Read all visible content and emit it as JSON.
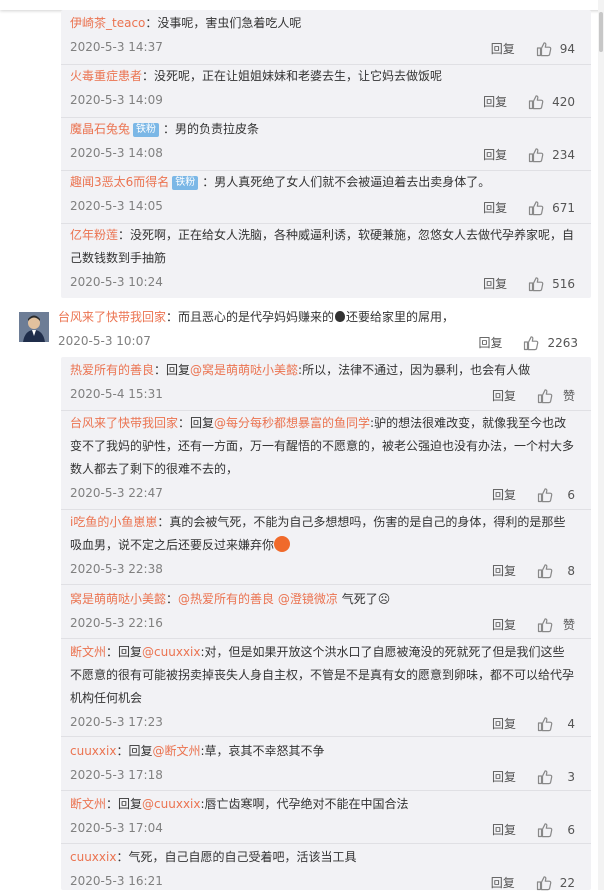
{
  "top_replies": [
    {
      "user": "伊崎茶_teaco",
      "text": "：没事呢，害虫们急着吃人呢",
      "time": "2020-5-3 14:37",
      "likes": "94"
    },
    {
      "user": "火毒重症患者",
      "text": "：没死呢，正在让姐姐妹妹和老婆去生，让它妈去做饭呢",
      "time": "2020-5-3 14:09",
      "likes": "420"
    },
    {
      "user": "魔晶石兔兔",
      "badge": "铁粉",
      "text": "：男的负责拉皮条",
      "time": "2020-5-3 14:08",
      "likes": "234"
    },
    {
      "user": "趣闻3恶太6而得名",
      "badge": "铁粉",
      "text": "：男人真死绝了女人们就不会被逼迫着去出卖身体了。",
      "time": "2020-5-3 14:05",
      "likes": "671"
    },
    {
      "user": "亿年粉莲",
      "text": "：没死啊，正在给女人洗脑，各种威逼利诱，软硬兼施，忽悠女人去做代孕养家呢，自己数钱数到手抽筋",
      "time": "2020-5-3 10:24",
      "likes": "516"
    }
  ],
  "main_comment": {
    "user": "台风来了快带我回家",
    "text_a": "：而且恶心的是代孕妈妈赚来的",
    "emoji_money": "money-bag",
    "text_b": "还要给家里的屌用，",
    "time": "2020-5-3 10:07",
    "likes": "2263"
  },
  "replies": [
    {
      "user": "热爱所有的善良",
      "reply_prefix": "：回复",
      "mention": "@窝是萌萌哒小美懿",
      "text": ":所以，法律不通过，因为暴利，也会有人做",
      "time": "2020-5-4 15:31",
      "likes": "赞"
    },
    {
      "user": "台风来了快带我回家",
      "reply_prefix": "：回复",
      "mention": "@每分每秒都想暴富的鱼同学",
      "text": ":驴的想法很难改变，就像我至今也改变不了我妈的驴性，还有一方面，万一有醒悟的不愿意的，被老公强迫也没有办法，一个村大多数人都去了剩下的很难不去的，",
      "time": "2020-5-3 22:47",
      "likes": "6"
    },
    {
      "user": "i吃鱼的小鱼崽崽",
      "text": "：真的会被气死，不能为自己多想想吗，伤害的是自己的身体，得利的是那些吸血男，说不定之后还要反过来嫌弃你",
      "time": "2020-5-3 22:38",
      "likes": "8"
    },
    {
      "user": "窝是萌萌哒小美懿",
      "reply_prefix": "：",
      "mention": "@热爱所有的善良",
      "mention2": "@澄镜微凉",
      "text": " 气死了☹",
      "time": "2020-5-3 22:16",
      "likes": "赞"
    },
    {
      "user": "断文州",
      "reply_prefix": "：回复",
      "mention": "@cuuxxix",
      "text": ":对，但是如果开放这个洪水口了自愿被淹没的死就死了但是我们这些不愿意的很有可能被拐卖掉丧失人身自主权，不管是不是真有女的愿意到卵味，都不可以给代孕机构任何机会",
      "time": "2020-5-3 17:23",
      "likes": "4"
    },
    {
      "user": "cuuxxix",
      "reply_prefix": "：回复",
      "mention": "@断文州",
      "text": ":草，哀其不幸怒其不争",
      "time": "2020-5-3 17:18",
      "likes": "3"
    },
    {
      "user": "断文州",
      "reply_prefix": "：回复",
      "mention": "@cuuxxix",
      "text": ":唇亡齿寒啊，代孕绝对不能在中国合法",
      "time": "2020-5-3 17:04",
      "likes": "6"
    },
    {
      "user": "cuuxxix",
      "text": "：气死，自己自愿的自己受着吧，活该当工具",
      "time": "2020-5-3 16:21",
      "likes": "22"
    }
  ],
  "labels": {
    "reply": "回复"
  },
  "colors": {
    "username": "#eb7350",
    "badge": "#7bb7e6",
    "reply_bg": "#f2f2f5",
    "time": "#808080"
  }
}
